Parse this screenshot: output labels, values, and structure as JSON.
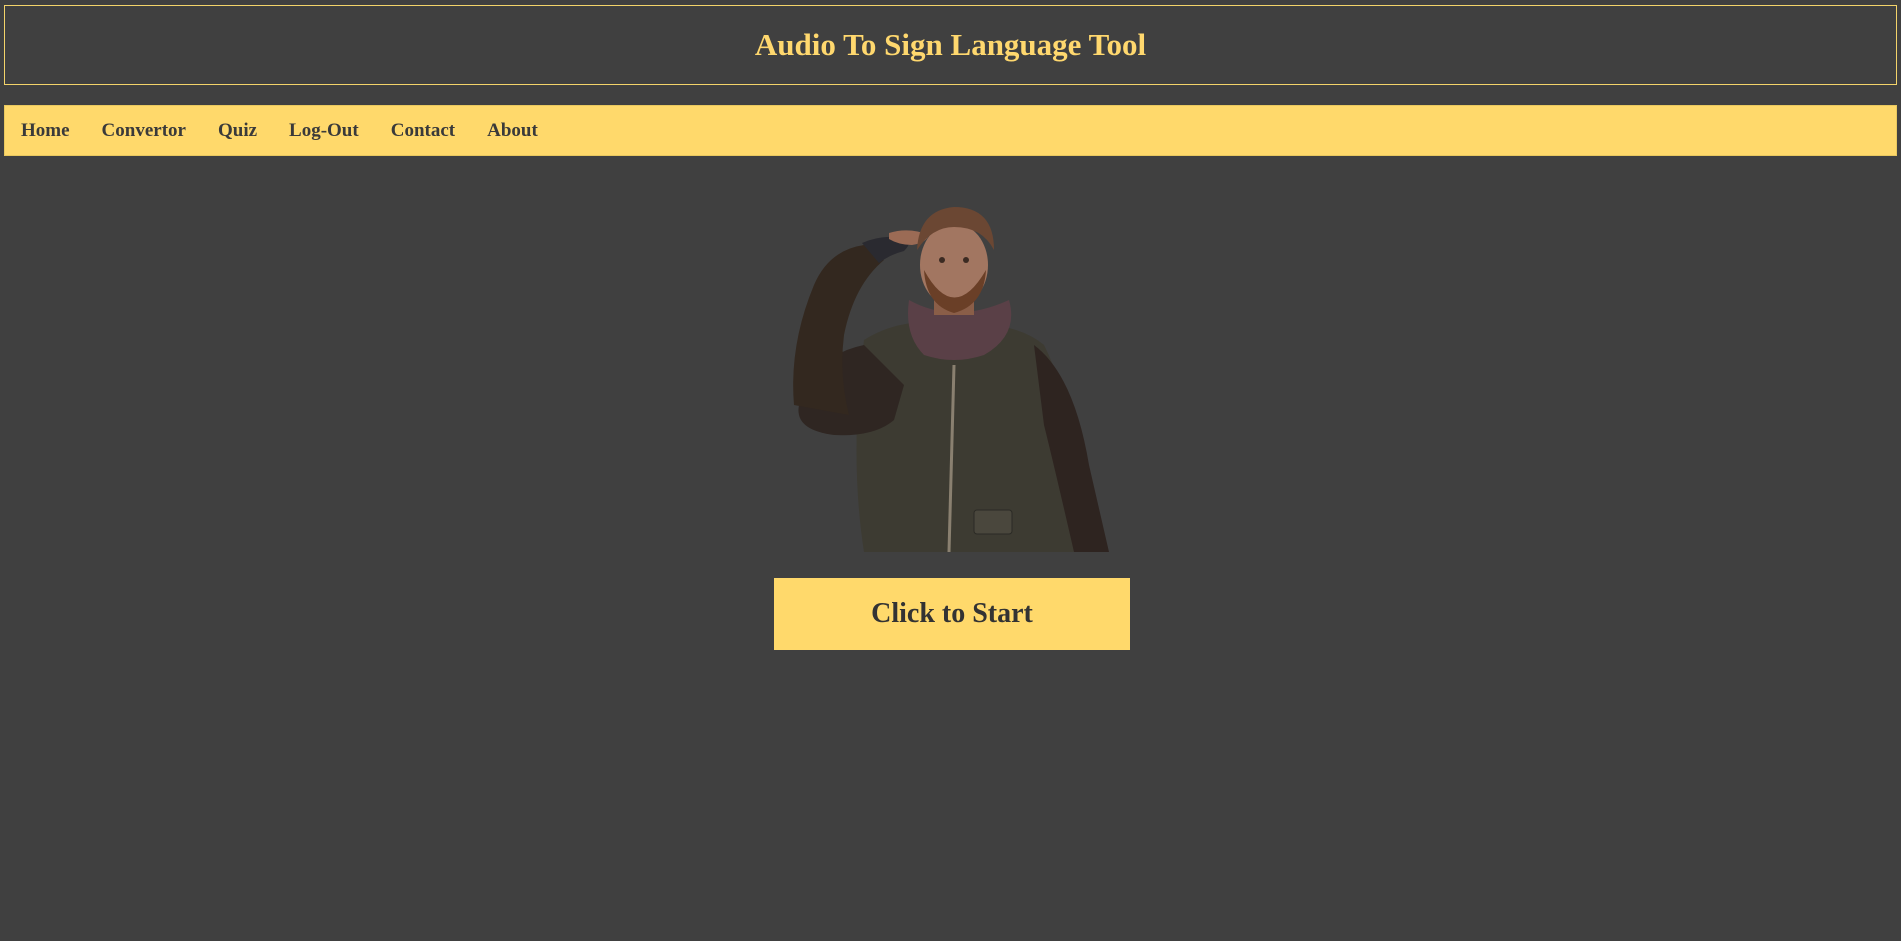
{
  "header": {
    "title": "Audio To Sign Language Tool"
  },
  "nav": {
    "items": [
      {
        "label": "Home"
      },
      {
        "label": "Convertor"
      },
      {
        "label": "Quiz"
      },
      {
        "label": "Log-Out"
      },
      {
        "label": "Contact"
      },
      {
        "label": "About"
      }
    ]
  },
  "main": {
    "avatar_icon": "sign-language-avatar",
    "start_button_label": "Click to Start"
  },
  "colors": {
    "background": "#404040",
    "accent": "#ffd96b",
    "nav_text": "#3a3a3a"
  }
}
